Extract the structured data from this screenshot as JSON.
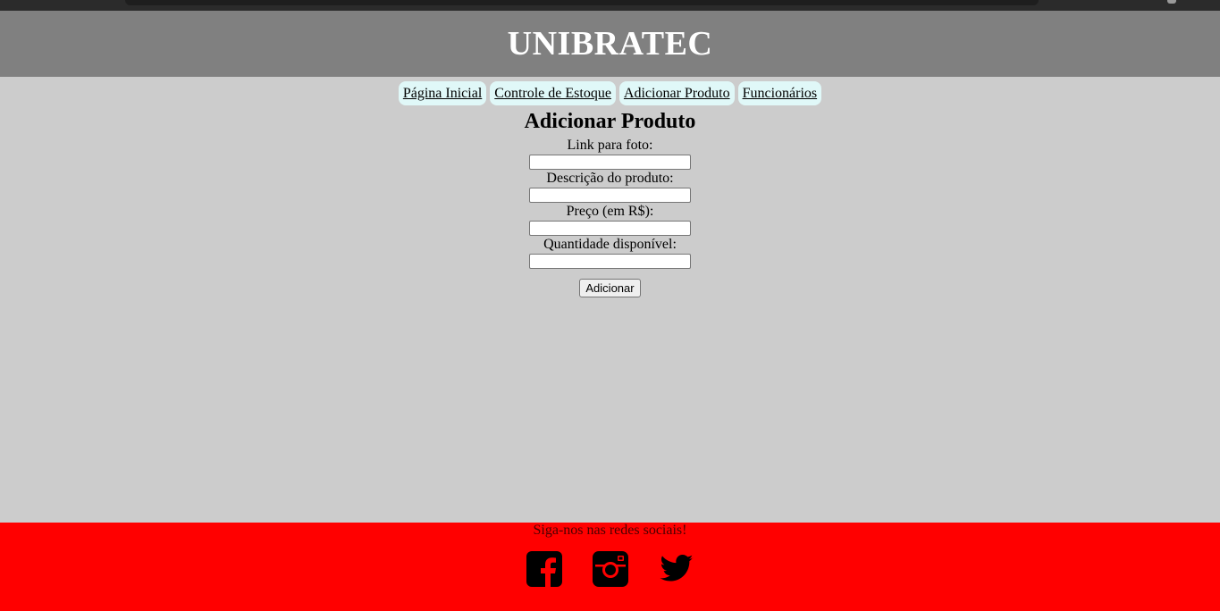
{
  "header": {
    "title": "UNIBRATEC"
  },
  "nav": {
    "items": [
      {
        "label": "Página Inicial"
      },
      {
        "label": "Controle de Estoque"
      },
      {
        "label": "Adicionar Produto"
      },
      {
        "label": "Funcionários"
      }
    ]
  },
  "form": {
    "title": "Adicionar Produto",
    "fields": [
      {
        "label": "Link para foto:",
        "value": ""
      },
      {
        "label": "Descrição do produto:",
        "value": ""
      },
      {
        "label": "Preço (em R$):",
        "value": ""
      },
      {
        "label": "Quantidade disponível:",
        "value": ""
      }
    ],
    "submit_label": "Adicionar"
  },
  "footer": {
    "follow_text": "Siga-nos nas redes sociais!",
    "icons": [
      "facebook-icon",
      "instagram-icon",
      "twitter-icon"
    ]
  },
  "colors": {
    "header_bg": "#808080",
    "page_bg": "#cccccc",
    "nav_item_bg": "#e0f8f8",
    "footer_bg": "#ff0000"
  }
}
